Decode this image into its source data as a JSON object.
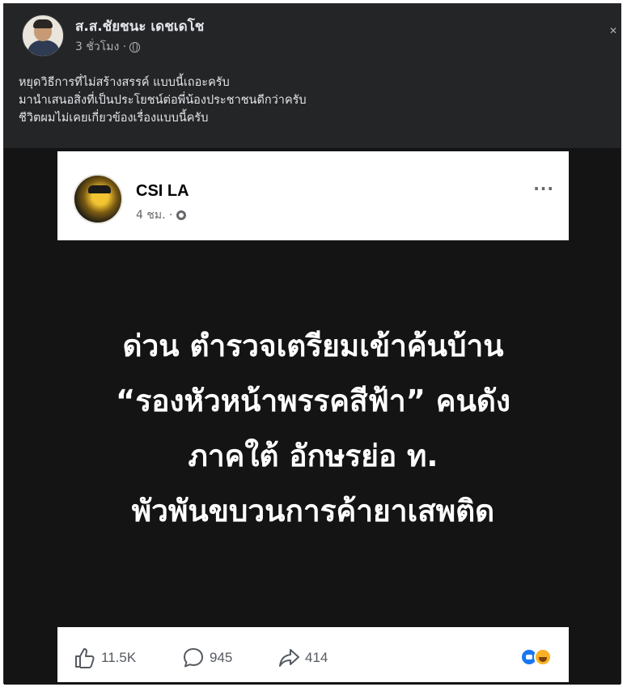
{
  "outer_post": {
    "author": "ส.ส.ชัยชนะ เดชเดโช",
    "time": "3 ชั่วโมง ·",
    "more_icon": "close-icon",
    "text_lines": [
      "หยุดวิธีการที่ไม่สร้างสรรค์ แบบนี้เถอะครับ",
      "มานำเสนอสิ่งที่เป็นประโยชน์ต่อพี่น้องประชาชนดีกว่าครับ",
      "ชีวิตผมไม่เคยเกี่ยวข้องเรื่องแบบนี้ครับ"
    ]
  },
  "shared_post": {
    "page_name": "CSI LA",
    "time": "4 ชม. ·",
    "more": "···",
    "headline_lines": [
      "ด่วน ตำรวจเตรียมเข้าค้นบ้าน",
      "“รองหัวหน้าพรรคสีฟ้า” คนดัง",
      "ภาคใต้ อักษรย่อ ท.",
      "พัวพันขบวนการค้ายาเสพติด"
    ],
    "actions": {
      "likes": "11.5K",
      "comments": "945",
      "shares": "414"
    },
    "reactions": [
      "like-reaction-icon",
      "haha-reaction-icon"
    ]
  },
  "colors": {
    "header_bg": "#242526",
    "shared_bg": "#141415",
    "headline_text": "#ffffff",
    "like_blue": "#1877f2",
    "haha_yellow": "#f7b125"
  }
}
